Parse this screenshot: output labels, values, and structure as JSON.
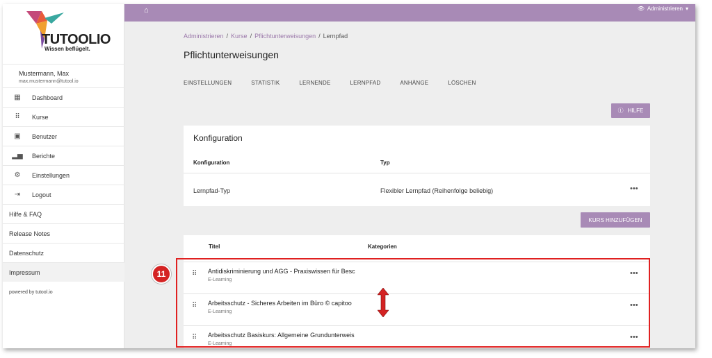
{
  "brand": {
    "name": "TUTOOLIO",
    "tagline": "Wissen beflügelt."
  },
  "user": {
    "name": "Mustermann, Max",
    "email": "max.mustermann@tutool.io"
  },
  "sidebar": {
    "items": [
      {
        "label": "Dashboard",
        "icon": "dashboard-icon"
      },
      {
        "label": "Kurse",
        "icon": "apps-grid-icon"
      },
      {
        "label": "Benutzer",
        "icon": "user-box-icon"
      },
      {
        "label": "Berichte",
        "icon": "bar-chart-icon"
      },
      {
        "label": "Einstellungen",
        "icon": "gear-icon"
      },
      {
        "label": "Logout",
        "icon": "logout-icon"
      }
    ],
    "links": [
      "Hilfe & FAQ",
      "Release Notes",
      "Datenschutz",
      "Impressum"
    ],
    "powered": "powered by tutool.io"
  },
  "topbar": {
    "admin_label": "Administrieren"
  },
  "breadcrumb": {
    "items": [
      "Administrieren",
      "Kurse",
      "Pflichtunterweisungen"
    ],
    "current": "Lernpfad"
  },
  "page_title": "Pflichtunterweisungen",
  "tabs": [
    "EINSTELLUNGEN",
    "STATISTIK",
    "LERNENDE",
    "LERNPFAD",
    "ANHÄNGE",
    "LÖSCHEN"
  ],
  "help_button": "HILFE",
  "config": {
    "title": "Konfiguration",
    "headers": [
      "Konfiguration",
      "Typ"
    ],
    "row": {
      "name": "Lernpfad-Typ",
      "type": "Flexibler Lernpfad (Reihenfolge beliebig)"
    }
  },
  "add_course_button": "KURS HINZUFÜGEN",
  "courses": {
    "headers": [
      "Titel",
      "Kategorien"
    ],
    "rows": [
      {
        "title": "Antidiskriminierung und AGG - Praxiswissen für Besc",
        "type": "E-Learning"
      },
      {
        "title": "Arbeitsschutz - Sicheres Arbeiten im Büro © capitoo",
        "type": "E-Learning"
      },
      {
        "title": "Arbeitsschutz Basiskurs: Allgemeine Grundunterweis",
        "type": "E-Learning"
      }
    ]
  },
  "annotation": {
    "step": "11",
    "color": "#e02020"
  },
  "colors": {
    "accent": "#a88ab6",
    "link": "#9b78aa"
  }
}
